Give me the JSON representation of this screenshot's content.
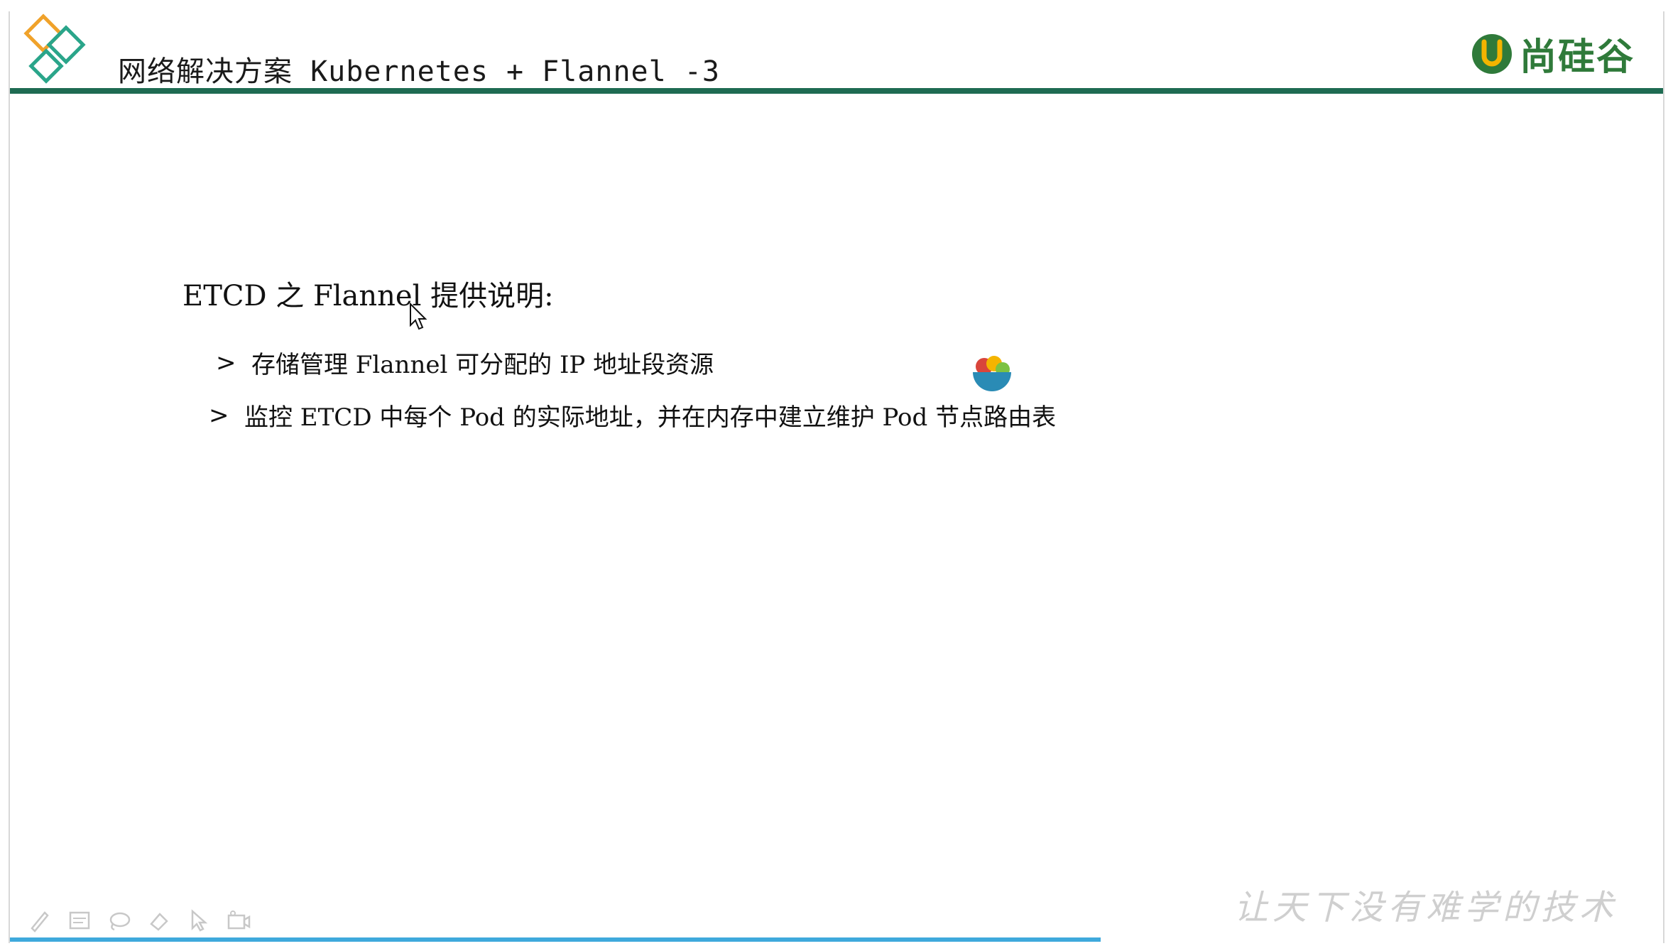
{
  "header": {
    "title": "网络解决方案 Kubernetes + Flannel -3",
    "brand_name": "尚硅谷",
    "rule_color": "#1e6b52"
  },
  "content": {
    "heading": "ETCD 之 Flannel 提供说明:",
    "bullets": [
      {
        "marker": ">",
        "text": "存储管理 Flannel 可分配的 IP 地址段资源"
      },
      {
        "marker": ">",
        "text": "监控 ETCD 中每个 Pod 的实际地址，并在内存中建立维护 Pod 节点路由表"
      }
    ]
  },
  "footer": {
    "slogan": "让天下没有难学的技术",
    "tools": [
      "pen-icon",
      "whiteboard-icon",
      "lasso-icon",
      "eraser-icon",
      "pointer-icon",
      "camera-icon"
    ],
    "progress_fraction": 0.66,
    "progress_color": "#3fa9dc"
  }
}
